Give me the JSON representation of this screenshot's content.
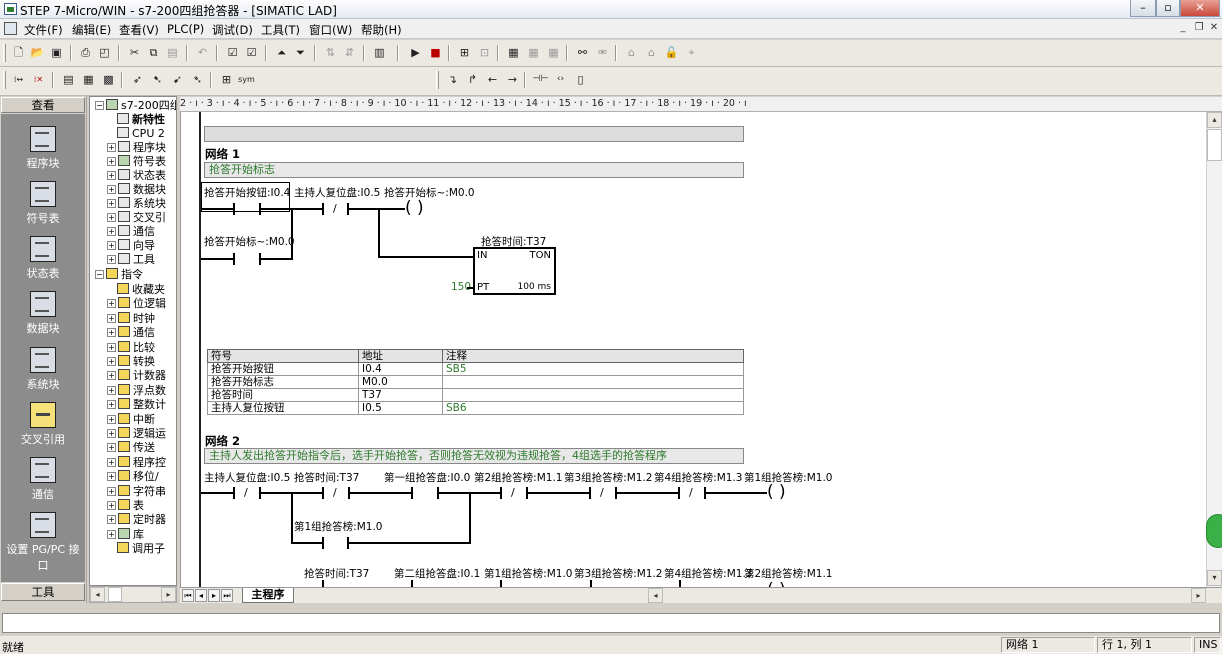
{
  "window": {
    "title": "STEP 7-Micro/WIN - s7-200四组抢答器 - [SIMATIC LAD]"
  },
  "menu": [
    "文件(F)",
    "编辑(E)",
    "查看(V)",
    "PLC(P)",
    "调试(D)",
    "工具(T)",
    "窗口(W)",
    "帮助(H)"
  ],
  "navbar": {
    "header": "查看",
    "items": [
      "程序块",
      "符号表",
      "状态表",
      "数据块",
      "系统块",
      "交叉引用",
      "通信",
      "设置 PG/PC 接口"
    ],
    "footer": "工具"
  },
  "tree": {
    "root": "s7-200四组",
    "items": [
      "新特性",
      "CPU 2",
      "程序块",
      "符号表",
      "状态表",
      "数据块",
      "系统块",
      "交叉引",
      "通信",
      "向导",
      "工具"
    ],
    "instr_root": "指令",
    "instr_items": [
      "收藏夹",
      "位逻辑",
      "时钟",
      "通信",
      "比较",
      "转换",
      "计数器",
      "浮点数",
      "整数计",
      "中断",
      "逻辑运",
      "传送",
      "程序控",
      "移位/",
      "字符串",
      "表",
      "定时器",
      "库",
      "调用子"
    ]
  },
  "ruler": {
    "text": "2 · ı · 3 · ı · 4 · ı · 5 · ı · 6 · ı · 7 · ı · 8 · ı · 9 · ı · 10 · ı · 11 · ı · 12 · ı · 13 · ı · 14 · ı · 15 · ı · 16 · ı · 17 · ı · 18 · ı · 19 · ı · 20 · ı"
  },
  "network1": {
    "title": "网络 1",
    "comment": "抢答开始标志",
    "c1": "抢答开始按钮:I0.4",
    "c2": "主持人复位盘:I0.5",
    "coil": "抢答开始标~:M0.0",
    "c3": "抢答开始标~:M0.0",
    "timer_name": "抢答时间:T37",
    "timer_in": "IN",
    "timer_type": "TON",
    "timer_pt": "PT",
    "timer_pt_val": "150",
    "timer_base": "100 ms",
    "coil_glyph": "(    )",
    "contact_nc": "/"
  },
  "symtable": {
    "headers": [
      "符号",
      "地址",
      "注释"
    ],
    "rows": [
      [
        "抢答开始按钮",
        "I0.4",
        "SB5"
      ],
      [
        "抢答开始标志",
        "M0.0",
        ""
      ],
      [
        "抢答时间",
        "T37",
        ""
      ],
      [
        "主持人复位按钮",
        "I0.5",
        "SB6"
      ]
    ]
  },
  "network2": {
    "title": "网络 2",
    "comment": "主持人发出抢答开始指令后，选手开始抢答，否则抢答无效视为违规抢答，4组选手的抢答程序",
    "r1": [
      "主持人复位盘:I0.5",
      "抢答时间:T37",
      "第一组抢答盘:I0.0",
      "第2组抢答榜:M1.1",
      "第3组抢答榜:M1.2",
      "第4组抢答榜:M1.3",
      "第1组抢答榜:M1.0"
    ],
    "latch": "第1组抢答榜:M1.0",
    "r2": [
      "抢答时间:T37",
      "第二组抢答盘:I0.1",
      "第1组抢答榜:M1.0",
      "第3组抢答榜:M1.2",
      "第4组抢答榜:M1.3",
      "第2组抢答榜:M1.1"
    ]
  },
  "tabs": {
    "main": "主程序"
  },
  "status": {
    "ready": "就绪",
    "network": "网络 1",
    "position": "行 1, 列 1",
    "mode": "INS"
  }
}
